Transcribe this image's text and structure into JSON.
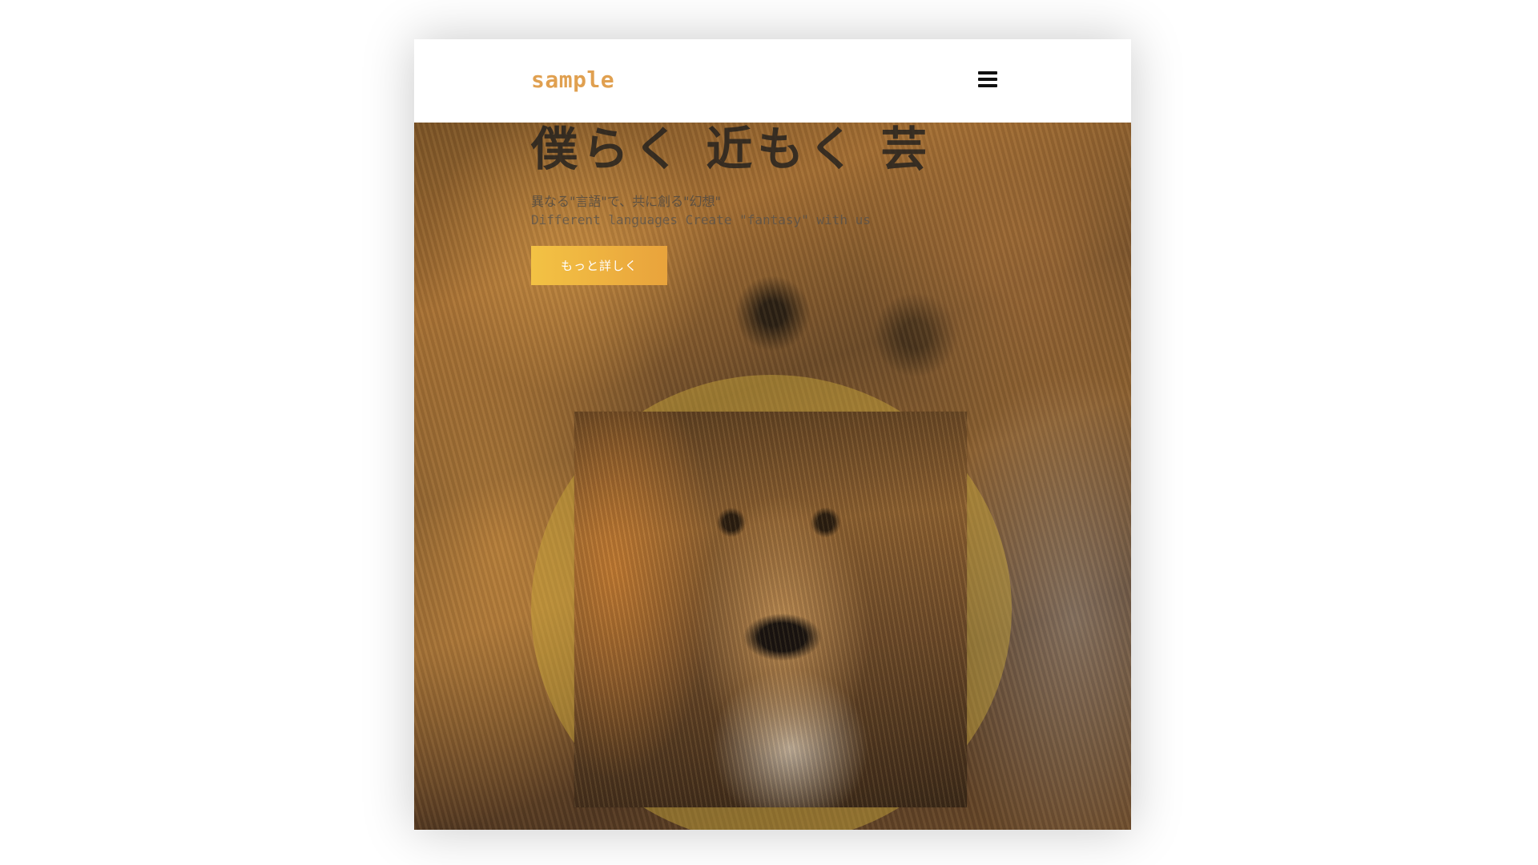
{
  "header": {
    "logo": "sample",
    "menu_icon": "hamburger-menu-icon"
  },
  "hero": {
    "headline": "僕らく 近もく 芸",
    "subtitle_jp": "異なる\"言語\"で、共に創る\"幻想\"",
    "subtitle_en": "Different languages Create \"fantasy\" with us",
    "cta_label": "もっと詳しく",
    "background_image": "lion-face-photo",
    "feature_image": "lion-portrait-photo"
  },
  "colors": {
    "logo": "#e0a050",
    "cta_start": "#f3c244",
    "cta_end": "#e9a33c",
    "accent_circle": "#cdaa3c",
    "menu_icon": "#111111"
  }
}
